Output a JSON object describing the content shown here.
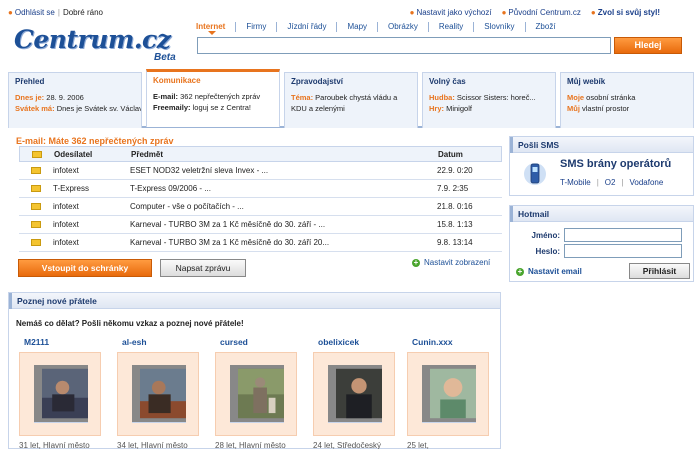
{
  "top": {
    "left_links": [
      "Odhlásit se",
      "Dobré ráno"
    ],
    "right_links": [
      "Nastavit jako výchozí",
      "Původní Centrum.cz",
      "Zvol si svůj styl!"
    ]
  },
  "logo": {
    "word": "Centrum.cz",
    "beta": "Beta"
  },
  "nav_tabs": [
    "Internet",
    "Firmy",
    "Jízdní řády",
    "Mapy",
    "Obrázky",
    "Reality",
    "Slovníky",
    "Zboží"
  ],
  "search": {
    "button": "Hledej"
  },
  "tabs": [
    {
      "title": "Přehled",
      "lines": [
        {
          "k": "Dnes je:",
          "v": " 28. 9. 2006"
        },
        {
          "k": "Svátek má:",
          "v": " Dnes je Svátek sv. Václava"
        }
      ]
    },
    {
      "title": "Komunikace",
      "lines": [
        {
          "k": "E-mail:",
          "v": " 362 nepřečtených zpráv"
        },
        {
          "k": "Freemaily:",
          "v": " loguj se z Centra!"
        }
      ]
    },
    {
      "title": "Zpravodajství",
      "lines": [
        {
          "k": "Téma:",
          "v": " Paroubek chystá vládu a KDU a zelenými"
        }
      ]
    },
    {
      "title": "Volný čas",
      "lines": [
        {
          "k": "Hudba:",
          "v": " Scissor Sisters: horeč..."
        },
        {
          "k": "Hry:",
          "v": " Minigolf"
        }
      ]
    },
    {
      "title": "Můj webík",
      "lines": [
        {
          "k": "Moje",
          "v": " osobní stránka"
        },
        {
          "k": "Můj",
          "v": " vlastní prostor"
        }
      ]
    }
  ],
  "email": {
    "header": "E-mail: Máte 362 nepřečtených zpráv",
    "columns": [
      "Odesílatel",
      "Předmět",
      "Datum"
    ],
    "rows": [
      {
        "from": "infotext",
        "subject": "ESET NOD32 veletržní sleva Invex - ...",
        "date": "22.9. 0:20"
      },
      {
        "from": "T-Express",
        "subject": "T-Express 09/2006 - ...",
        "date": "7.9. 2:35"
      },
      {
        "from": "infotext",
        "subject": "Computer - vše o počítačích - ...",
        "date": "21.8. 0:16"
      },
      {
        "from": "infotext",
        "subject": "Karneval - TURBO 3M za 1 Kč měsíčně do 30. září - ...",
        "date": "15.8. 1:13"
      },
      {
        "from": "infotext",
        "subject": "Karneval - TURBO 3M za 1 Kč měsíčně do 30. září 20...",
        "date": "9.8. 13:14"
      }
    ],
    "btn_inbox": "Vstoupit do schránky",
    "btn_write": "Napsat zprávu",
    "settings": "Nastavit zobrazení"
  },
  "sms": {
    "header": "Pošli SMS",
    "title": "SMS brány operátorů",
    "operators": [
      "T-Mobile",
      "O2",
      "Vodafone"
    ]
  },
  "hotmail": {
    "header": "Hotmail",
    "name_label": "Jméno:",
    "pass_label": "Heslo:",
    "settings": "Nastavit email",
    "login": "Přihlásit"
  },
  "friends": {
    "header": "Poznej nové přátele",
    "intro": "Nemáš co dělat? Pošli někomu vzkaz a poznej nové přátele!",
    "people": [
      {
        "name": "M2111",
        "info": "31 let, Hlavní město"
      },
      {
        "name": "al-esh",
        "info": "34 let, Hlavní město"
      },
      {
        "name": "cursed",
        "info": "28 let, Hlavní město"
      },
      {
        "name": "obelixicek",
        "info": "24 let, Středočeský"
      },
      {
        "name": "Cunin.xxx",
        "info": "25 let,"
      }
    ]
  },
  "colors": {
    "accent": "#e8741e",
    "brand": "#1d5097"
  }
}
